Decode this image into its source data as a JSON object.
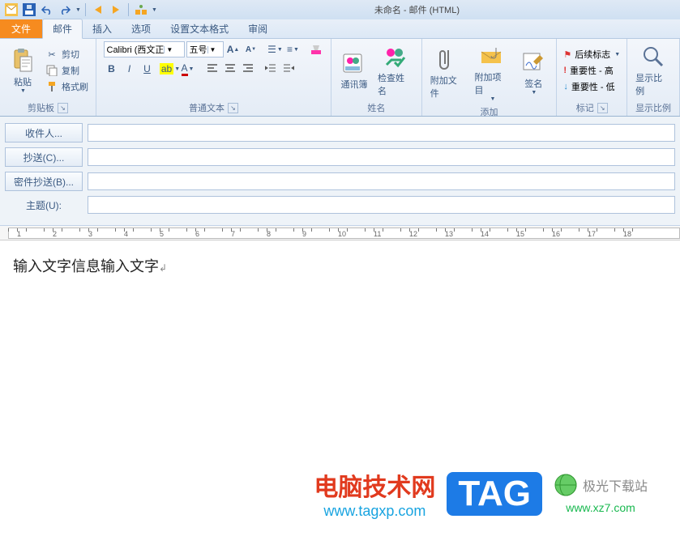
{
  "title": "未命名 - 邮件 (HTML)",
  "tabs": {
    "file": "文件",
    "mail": "邮件",
    "insert": "插入",
    "options": "选项",
    "format": "设置文本格式",
    "review": "审阅"
  },
  "clipboard": {
    "paste": "粘贴",
    "cut": "剪切",
    "copy": "复制",
    "format_painter": "格式刷",
    "group": "剪贴板"
  },
  "font": {
    "name": "Calibri (西文正",
    "size": "五号",
    "group": "普通文本"
  },
  "names": {
    "addressbook": "通讯簿",
    "check": "检查姓名",
    "group": "姓名"
  },
  "add": {
    "attach_file": "附加文件",
    "attach_item": "附加项目",
    "signature": "签名",
    "group": "添加"
  },
  "tags": {
    "followup": "后续标志",
    "high": "重要性 - 高",
    "low": "重要性 - 低",
    "group": "标记"
  },
  "zoom": {
    "label": "显示比例",
    "group": "显示比例"
  },
  "header": {
    "to": "收件人...",
    "cc": "抄送(C)...",
    "bcc": "密件抄送(B)...",
    "subject": "主题(U):"
  },
  "body_text": "输入文字信息输入文字",
  "ruler_nums": [
    "1",
    "2",
    "3",
    "4",
    "5",
    "6",
    "7",
    "8",
    "9",
    "10",
    "11",
    "12",
    "13",
    "14",
    "15",
    "16",
    "17",
    "18"
  ],
  "watermark": {
    "site1": "电脑技术网",
    "url1": "www.tagxp.com",
    "tag": "TAG",
    "site2": "极光下载站",
    "url2": "www.xz7.com"
  }
}
